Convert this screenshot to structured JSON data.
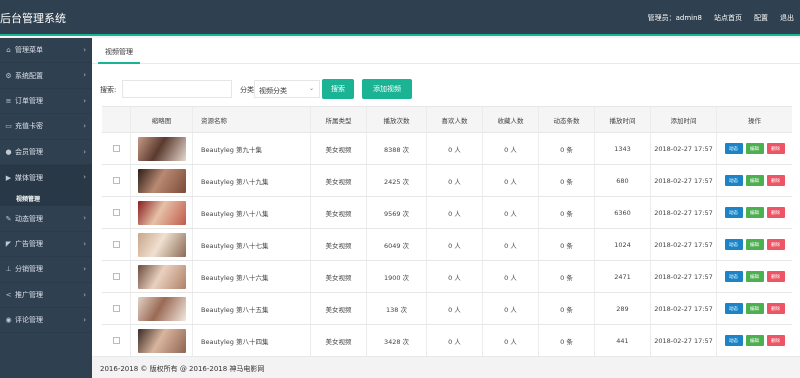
{
  "app": {
    "title": "后台管理系统"
  },
  "topnav": [
    {
      "label": "管理员：admin8"
    },
    {
      "label": "站点首页"
    },
    {
      "label": "配置"
    },
    {
      "label": "退出"
    }
  ],
  "sidebar": {
    "items": [
      {
        "label": "管理菜单",
        "icon": "home-icon"
      },
      {
        "label": "系统配置",
        "icon": "gears-icon"
      },
      {
        "label": "订单管理",
        "icon": "list-icon"
      },
      {
        "label": "充值卡密",
        "icon": "card-icon"
      },
      {
        "label": "会员管理",
        "icon": "user-icon"
      },
      {
        "label": "媒体管理",
        "icon": "video-icon"
      },
      {
        "label": "动态管理",
        "icon": "edit-icon"
      },
      {
        "label": "广告管理",
        "icon": "bullhorn-icon"
      },
      {
        "label": "分销管理",
        "icon": "sitemap-icon"
      },
      {
        "label": "推广管理",
        "icon": "share-icon"
      },
      {
        "label": "评论管理",
        "icon": "comment-icon"
      }
    ],
    "sub_item": "视频管理"
  },
  "tab": {
    "label": "视频管理"
  },
  "filters": {
    "search_label": "搜索:",
    "search_value": "",
    "category_label": "分类:",
    "category_selected": "视频分类",
    "search_button": "搜索",
    "add_button": "添加视频"
  },
  "table": {
    "headers": [
      "",
      "缩略图",
      "资源名称",
      "所属类型",
      "播放次数",
      "喜欢人数",
      "收藏人数",
      "动态条数",
      "播放时间",
      "添加时间",
      "操作"
    ],
    "op_labels": [
      "动态",
      "编辑",
      "删除"
    ],
    "rows": [
      {
        "name": "Beautyleg 第九十集",
        "type": "美女视频",
        "plays": "8388 次",
        "likes": "0 人",
        "favs": "0 人",
        "dyn": "0 条",
        "dur": "1343",
        "added": "2018-02-27 17:57"
      },
      {
        "name": "Beautyleg 第八十九集",
        "type": "美女视频",
        "plays": "2425 次",
        "likes": "0 人",
        "favs": "0 人",
        "dyn": "0 条",
        "dur": "680",
        "added": "2018-02-27 17:57"
      },
      {
        "name": "Beautyleg 第八十八集",
        "type": "美女视频",
        "plays": "9569 次",
        "likes": "0 人",
        "favs": "0 人",
        "dyn": "0 条",
        "dur": "6360",
        "added": "2018-02-27 17:57"
      },
      {
        "name": "Beautyleg 第八十七集",
        "type": "美女视频",
        "plays": "6049 次",
        "likes": "0 人",
        "favs": "0 人",
        "dyn": "0 条",
        "dur": "1024",
        "added": "2018-02-27 17:57"
      },
      {
        "name": "Beautyleg 第八十六集",
        "type": "美女视频",
        "plays": "1900 次",
        "likes": "0 人",
        "favs": "0 人",
        "dyn": "0 条",
        "dur": "2471",
        "added": "2018-02-27 17:57"
      },
      {
        "name": "Beautyleg 第八十五集",
        "type": "美女视频",
        "plays": "138 次",
        "likes": "0 人",
        "favs": "0 人",
        "dyn": "0 条",
        "dur": "289",
        "added": "2018-02-27 17:57"
      },
      {
        "name": "Beautyleg 第八十四集",
        "type": "美女视频",
        "plays": "3428 次",
        "likes": "0 人",
        "favs": "0 人",
        "dyn": "0 条",
        "dur": "441",
        "added": "2018-02-27 17:57"
      }
    ]
  },
  "footer": {
    "text": "2016-2018 © 版权所有 @ 2016-2018 神马电影网"
  },
  "colors": {
    "accent": "#1ab394",
    "sidebar": "#2f4050",
    "op_dynamic": "#1c84c6",
    "op_edit": "#4caf50",
    "op_delete": "#ed5565"
  }
}
